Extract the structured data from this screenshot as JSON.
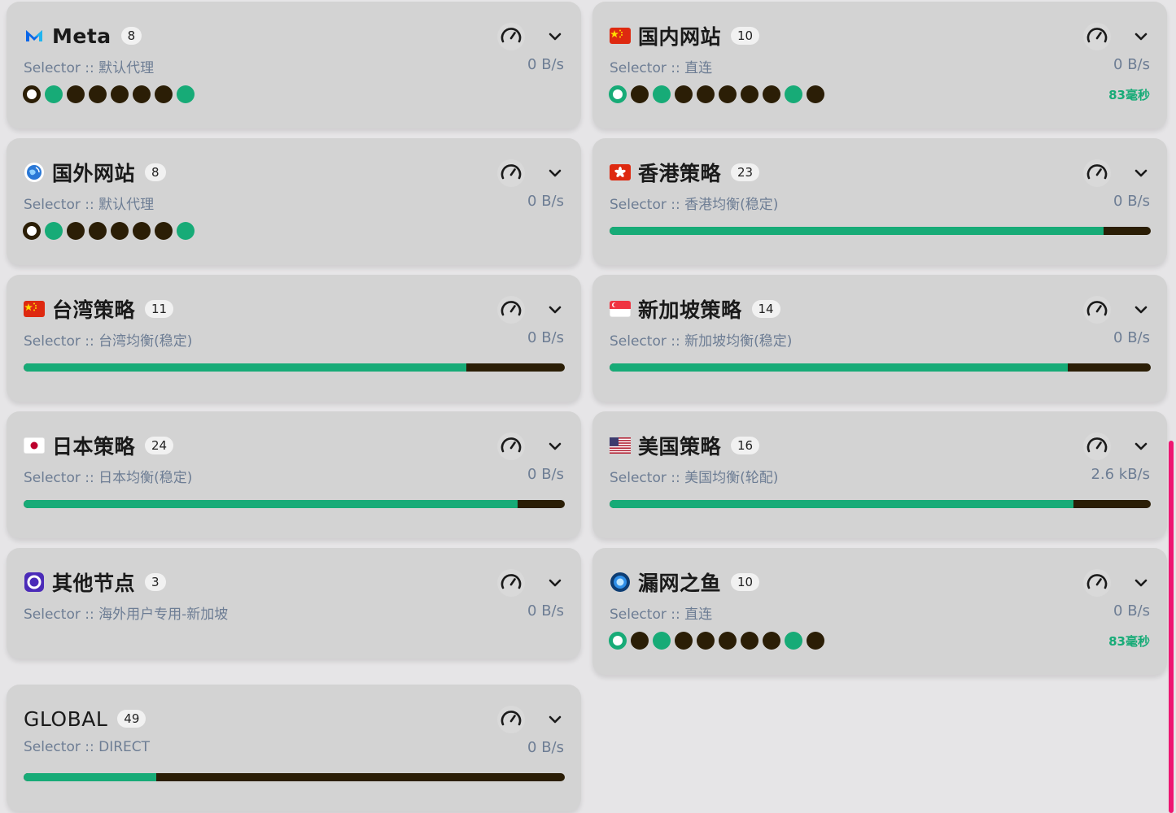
{
  "groups": [
    {
      "name": "Meta",
      "count": "8",
      "type": "Selector",
      "selected": "默认代理",
      "speed": "0 B/s",
      "icon": "meta-icon",
      "nodes": [
        "sel-dark",
        "green",
        "dark",
        "dark",
        "dark",
        "dark",
        "dark",
        "green"
      ]
    },
    {
      "name": "国内网站",
      "count": "10",
      "type": "Selector",
      "selected": "直连",
      "speed": "0 B/s",
      "icon": "china-flag-icon",
      "latency": "83毫秒",
      "nodes": [
        "sel-green",
        "dark",
        "green",
        "dark",
        "dark",
        "dark",
        "dark",
        "dark",
        "green",
        "dark"
      ]
    },
    {
      "name": "国外网站",
      "count": "8",
      "type": "Selector",
      "selected": "默认代理",
      "speed": "0 B/s",
      "icon": "globe-icon",
      "nodes": [
        "sel-dark",
        "green",
        "dark",
        "dark",
        "dark",
        "dark",
        "dark",
        "green"
      ]
    },
    {
      "name": "香港策略",
      "count": "23",
      "type": "Selector",
      "selected": "香港均衡(稳定)",
      "speed": "0 B/s",
      "icon": "hong-kong-flag-icon",
      "progress": 0.913
    },
    {
      "name": "台湾策略",
      "count": "11",
      "type": "Selector",
      "selected": "台湾均衡(稳定)",
      "speed": "0 B/s",
      "icon": "china-flag-icon",
      "progress": 0.818
    },
    {
      "name": "新加坡策略",
      "count": "14",
      "type": "Selector",
      "selected": "新加坡均衡(稳定)",
      "speed": "0 B/s",
      "icon": "singapore-flag-icon",
      "progress": 0.846
    },
    {
      "name": "日本策略",
      "count": "24",
      "type": "Selector",
      "selected": "日本均衡(稳定)",
      "speed": "0 B/s",
      "icon": "japan-flag-icon",
      "progress": 0.913
    },
    {
      "name": "美国策略",
      "count": "16",
      "type": "Selector",
      "selected": "美国均衡(轮配)",
      "speed": "2.6 kB/s",
      "icon": "usa-flag-icon",
      "progress": 0.857
    },
    {
      "name": "其他节点",
      "count": "3",
      "type": "Selector",
      "selected": "海外用户专用-新加坡",
      "speed": "0 B/s",
      "icon": "other-nodes-icon"
    },
    {
      "name": "漏网之鱼",
      "count": "10",
      "type": "Selector",
      "selected": "直连",
      "speed": "0 B/s",
      "icon": "fish-icon",
      "latency": "83毫秒",
      "nodes": [
        "sel-green",
        "dark",
        "green",
        "dark",
        "dark",
        "dark",
        "dark",
        "dark",
        "green",
        "dark"
      ]
    },
    {
      "name": "GLOBAL",
      "count": "49",
      "type": "Selector",
      "selected": "DIRECT",
      "speed": "0 B/s",
      "icon": "",
      "progress": 0.245
    }
  ],
  "separator": " :: ",
  "colors": {
    "accent": "#17ab77",
    "dark": "#2b1e06",
    "muted": "#6d7d94",
    "scrollbar": "#ee1772"
  }
}
